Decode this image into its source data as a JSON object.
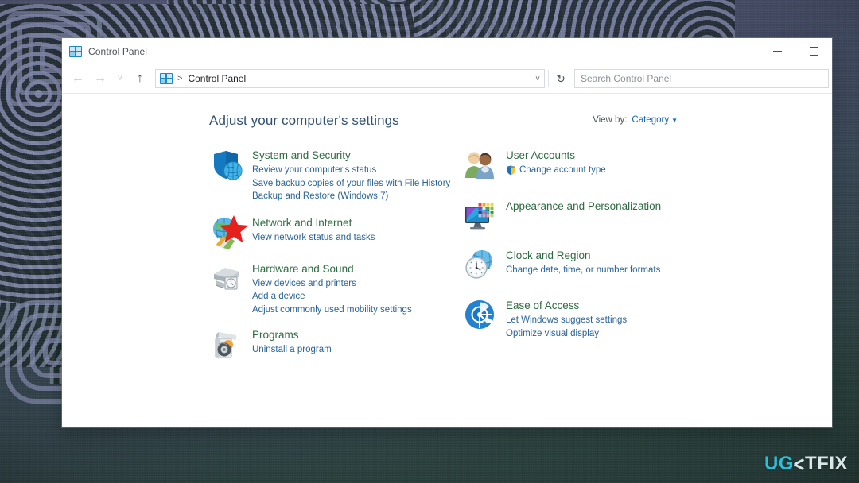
{
  "window": {
    "title": "Control Panel",
    "title_icon": "control-panel-icon",
    "buttons": {
      "minimize": "minimize-icon",
      "maximize": "maximize-icon"
    }
  },
  "navbar": {
    "back": "back-arrow-icon",
    "forward": "forward-arrow-icon",
    "recent": "chevron-down-icon",
    "up": "up-arrow-icon",
    "refresh": "refresh-icon",
    "breadcrumb": {
      "icon": "control-panel-icon",
      "separator": ">",
      "path": "Control Panel",
      "dropdown": "chevron-down-icon"
    },
    "search": {
      "placeholder": "Search Control Panel",
      "value": "",
      "icon": "search-icon"
    }
  },
  "content": {
    "page_title": "Adjust your computer's settings",
    "view_by": {
      "label": "View by:",
      "value": "Category",
      "caret": "chevron-down-icon"
    },
    "annotation": {
      "type": "red-star-marker",
      "target": "Network and Internet",
      "color": "#e4211c"
    },
    "left_column": [
      {
        "icon": "system-and-security-icon",
        "title": "System and Security",
        "links": [
          "Review your computer's status",
          "Save backup copies of your files with File History",
          "Backup and Restore (Windows 7)"
        ]
      },
      {
        "icon": "network-and-internet-icon",
        "title": "Network and Internet",
        "links": [
          "View network status and tasks"
        ]
      },
      {
        "icon": "hardware-and-sound-icon",
        "title": "Hardware and Sound",
        "links": [
          "View devices and printers",
          "Add a device",
          "Adjust commonly used mobility settings"
        ]
      },
      {
        "icon": "programs-icon",
        "title": "Programs",
        "links": [
          "Uninstall a program"
        ]
      }
    ],
    "right_column": [
      {
        "icon": "user-accounts-icon",
        "title": "User Accounts",
        "links": [
          "Change account type"
        ],
        "link_shield": true,
        "shield_icon": "uac-shield-icon"
      },
      {
        "icon": "appearance-and-personalization-icon",
        "title": "Appearance and Personalization",
        "links": []
      },
      {
        "icon": "clock-and-region-icon",
        "title": "Clock and Region",
        "links": [
          "Change date, time, or number formats"
        ]
      },
      {
        "icon": "ease-of-access-icon",
        "title": "Ease of Access",
        "links": [
          "Let Windows suggest settings",
          "Optimize visual display"
        ]
      }
    ]
  },
  "watermark": {
    "part_a": "UG",
    "mark": "logo-mark",
    "part_b": "TFIX"
  },
  "colors": {
    "category_title": "#2e6b42",
    "category_link": "#2a6496",
    "page_title": "#2f5070",
    "view_by_value": "#1769b5",
    "accent_star": "#e4211c",
    "watermark_accent": "#2ebfd8"
  }
}
